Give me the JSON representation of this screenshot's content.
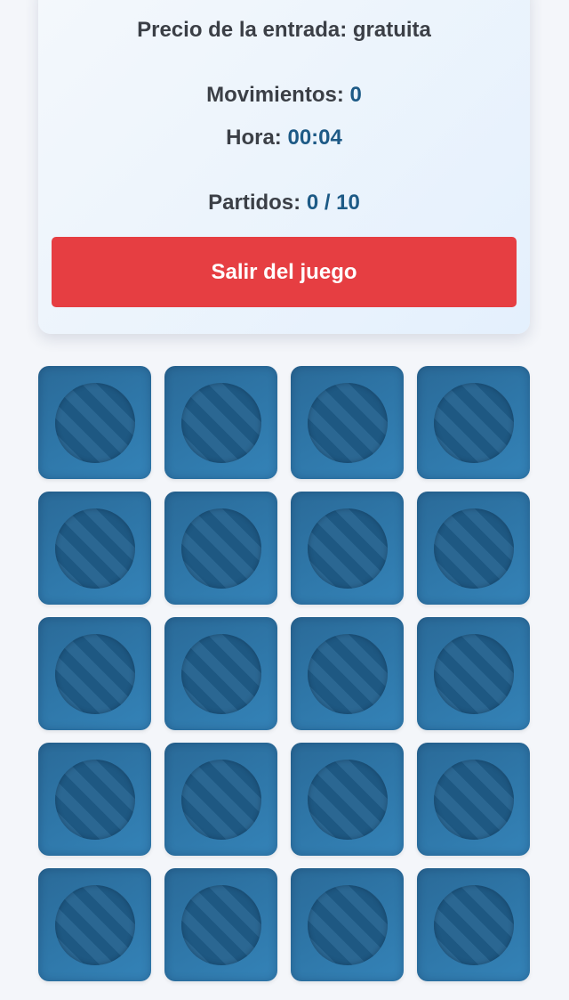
{
  "stats": {
    "price_label": "Precio de la entrada: ",
    "price_value": "gratuita",
    "moves_label": "Movimientos: ",
    "moves_value": "0",
    "time_label": "Hora: ",
    "time_value": "00:04",
    "matches_label": "Partidos: ",
    "matches_value": "0 / 10"
  },
  "exit_button": {
    "label": "Salir del juego",
    "color": "#e63e42"
  },
  "board": {
    "rows": 5,
    "columns": 4,
    "card_state": "face-down",
    "card_back_icon": "striped-disc-icon",
    "card_color": "#2f78aa"
  }
}
